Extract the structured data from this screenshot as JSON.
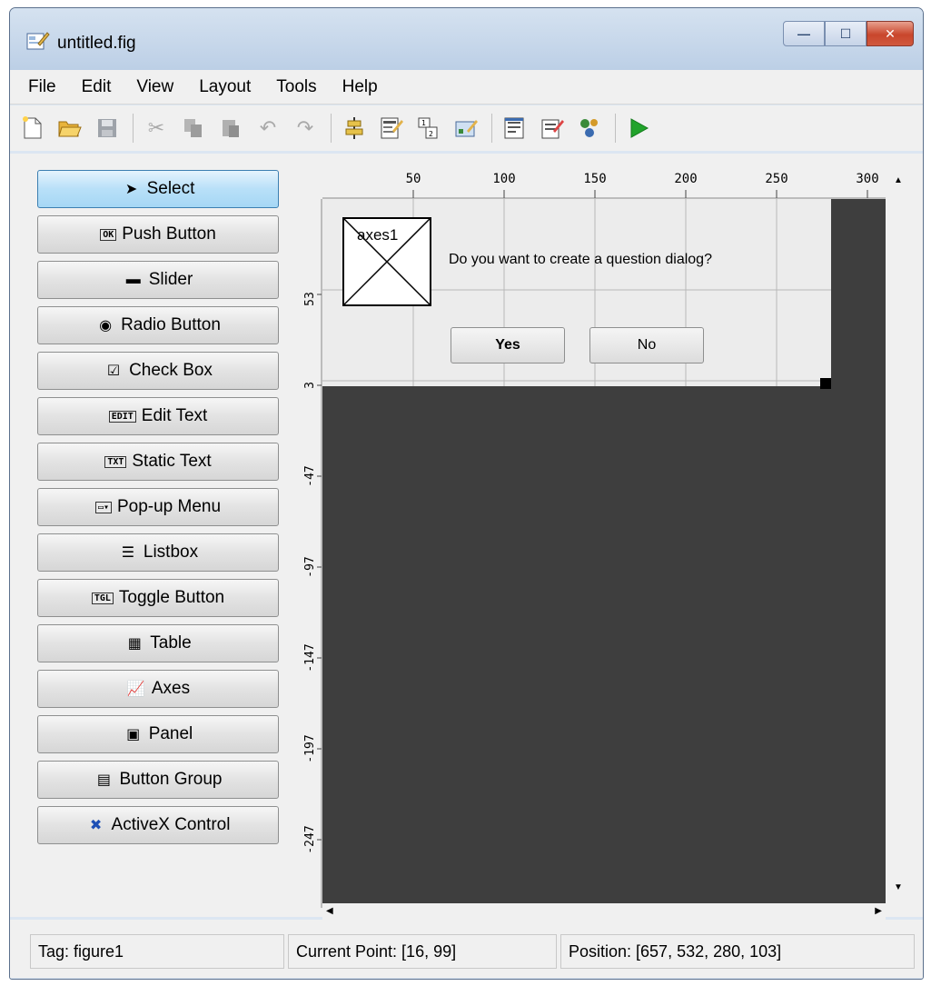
{
  "window": {
    "title": "untitled.fig",
    "minimize": "—",
    "maximize": "☐",
    "close": "✕"
  },
  "menu": [
    "File",
    "Edit",
    "View",
    "Layout",
    "Tools",
    "Help"
  ],
  "toolbar": {
    "icons": [
      "new-icon",
      "open-icon",
      "save-icon",
      "cut-icon",
      "copy-icon",
      "paste-icon",
      "undo-icon",
      "redo-icon",
      "align-icon",
      "menu-editor-icon",
      "tab-order-icon",
      "toolbar-editor-icon",
      "editor-icon",
      "property-inspector-icon",
      "object-browser-icon",
      "run-icon"
    ]
  },
  "palette": [
    {
      "label": "Select",
      "icon": "arrow-icon"
    },
    {
      "label": "Push Button",
      "icon": "push-button-icon"
    },
    {
      "label": "Slider",
      "icon": "slider-icon"
    },
    {
      "label": "Radio Button",
      "icon": "radio-icon"
    },
    {
      "label": "Check Box",
      "icon": "checkbox-icon"
    },
    {
      "label": "Edit Text",
      "icon": "edit-text-icon"
    },
    {
      "label": "Static Text",
      "icon": "static-text-icon"
    },
    {
      "label": "Pop-up Menu",
      "icon": "popup-icon"
    },
    {
      "label": "Listbox",
      "icon": "listbox-icon"
    },
    {
      "label": "Toggle Button",
      "icon": "toggle-icon"
    },
    {
      "label": "Table",
      "icon": "table-icon"
    },
    {
      "label": "Axes",
      "icon": "axes-icon"
    },
    {
      "label": "Panel",
      "icon": "panel-icon"
    },
    {
      "label": "Button Group",
      "icon": "button-group-icon"
    },
    {
      "label": "ActiveX Control",
      "icon": "activex-icon"
    }
  ],
  "ruler": {
    "top_ticks": [
      "50",
      "100",
      "150",
      "200",
      "250",
      "300"
    ],
    "left_ticks": [
      "53",
      "3",
      "-47",
      "-97",
      "-147",
      "-197",
      "-247"
    ]
  },
  "figure": {
    "axes_label": "axes1",
    "question": "Do you want to create a question dialog?",
    "yes_label": "Yes",
    "no_label": "No"
  },
  "status": {
    "tag": "Tag: figure1",
    "current_point": "Current Point:  [16, 99]",
    "position": "Position: [657, 532, 280, 103]"
  },
  "colors": {
    "select_accent": "#b8e0f8",
    "workspace": "#3e3e3e",
    "run_green": "#21a32b"
  }
}
